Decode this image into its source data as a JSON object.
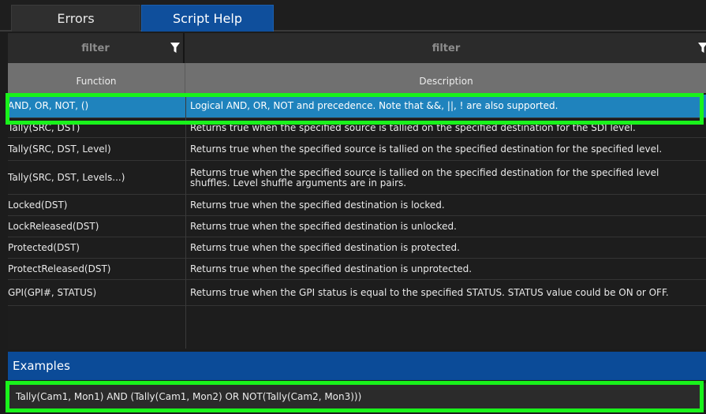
{
  "tabs": [
    {
      "label": "Errors",
      "active": false
    },
    {
      "label": "Script Help",
      "active": true
    }
  ],
  "filters": {
    "function_placeholder": "filter",
    "description_placeholder": "filter"
  },
  "columns": {
    "function": "Function",
    "description": "Description"
  },
  "rows": [
    {
      "function": "AND, OR, NOT, ()",
      "description": "Logical AND, OR, NOT and precedence. Note that &&, ||, ! are also supported."
    },
    {
      "function": "Tally(SRC, DST)",
      "description": "Returns true when the specified source is tallied on the specified destination for the SDI level."
    },
    {
      "function": "Tally(SRC, DST, Level)",
      "description": "Returns true when the specified source is tallied on the specified destination for the specified level."
    },
    {
      "function": "Tally(SRC, DST, Levels...)",
      "description": "Returns true when the specified source is tallied on the specified destination for the specified level shuffles. Level shuffle arguments are in pairs."
    },
    {
      "function": "Locked(DST)",
      "description": "Returns true when the specified destination is locked."
    },
    {
      "function": "LockReleased(DST)",
      "description": "Returns true when the specified destination is unlocked."
    },
    {
      "function": "Protected(DST)",
      "description": "Returns true when the specified destination is protected."
    },
    {
      "function": "ProtectReleased(DST)",
      "description": "Returns true when the specified destination is unprotected."
    },
    {
      "function": "GPI(GPI#, STATUS)",
      "description": "Returns true when the GPI status is equal to the specified STATUS. STATUS value could be ON or OFF."
    }
  ],
  "examples": {
    "title": "Examples",
    "text": "Tally(Cam1, Mon1) AND (Tally(Cam1, Mon2) OR NOT(Tally(Cam2, Mon3)))"
  },
  "colors": {
    "accent_tab": "#0f4f9c",
    "selected_row": "#1f83bd",
    "highlight": "#19f21b",
    "header_bg": "#707070"
  }
}
